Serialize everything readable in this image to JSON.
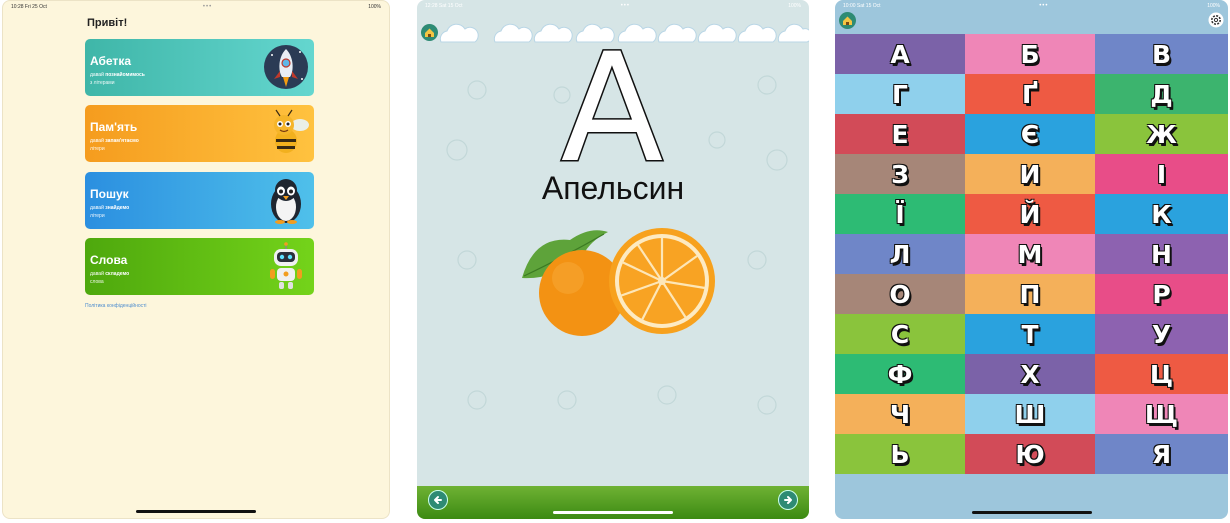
{
  "screen1": {
    "status_left": "10:28  Fri 25 Oct",
    "status_right": "100%",
    "greeting": "Привіт!",
    "cards": [
      {
        "title": "Абетка",
        "sub_plain": "давай ",
        "sub_bold": "познайомимось",
        "sub2": "з літерами",
        "mascot": "rocket-icon"
      },
      {
        "title": "Пам'ять",
        "sub_plain": "давай ",
        "sub_bold": "запам'ятаємо",
        "sub2": "літери",
        "mascot": "bee-icon"
      },
      {
        "title": "Пошук",
        "sub_plain": "давай ",
        "sub_bold": "знайдемо",
        "sub2": "літери",
        "mascot": "penguin-icon"
      },
      {
        "title": "Слова",
        "sub_plain": "давай ",
        "sub_bold": "складемо",
        "sub2": "слова",
        "mascot": "robot-icon"
      }
    ],
    "privacy": "Політика конфіденційності"
  },
  "screen2": {
    "status_left": "12:28  Sat 15 Oct",
    "status_right": "100%",
    "letter": "А",
    "word": "Апельсин",
    "image": "orange-icon"
  },
  "screen3": {
    "status_left": "10:00  Sat 15 Oct",
    "status_right": "100%",
    "letters": [
      "А",
      "Б",
      "В",
      "Г",
      "Ґ",
      "Д",
      "Е",
      "Є",
      "Ж",
      "З",
      "И",
      "І",
      "Ї",
      "Й",
      "К",
      "Л",
      "М",
      "Н",
      "О",
      "П",
      "Р",
      "С",
      "Т",
      "У",
      "Ф",
      "Х",
      "Ц",
      "Ч",
      "Ш",
      "Щ",
      "Ь",
      "Ю",
      "Я"
    ],
    "colors": [
      "#7b62a8",
      "#ef86b7",
      "#6f86c8",
      "#8fd0ec",
      "#ee5a43",
      "#3cb46e",
      "#d24b58",
      "#2aa2de",
      "#8ac43c",
      "#a68678",
      "#f4b05a",
      "#e84d88",
      "#2dbb74",
      "#ee5a43",
      "#2aa2de",
      "#6f86c8",
      "#ef86b7",
      "#8d62b0",
      "#a68678",
      "#f4b05a",
      "#e84d88",
      "#8ac43c",
      "#2aa2de",
      "#8d62b0",
      "#2dbb74",
      "#7b62a8",
      "#ee5a43",
      "#f4b05a",
      "#8fd0ec",
      "#ef86b7",
      "#8ac43c",
      "#d24b58",
      "#6f86c8"
    ]
  }
}
